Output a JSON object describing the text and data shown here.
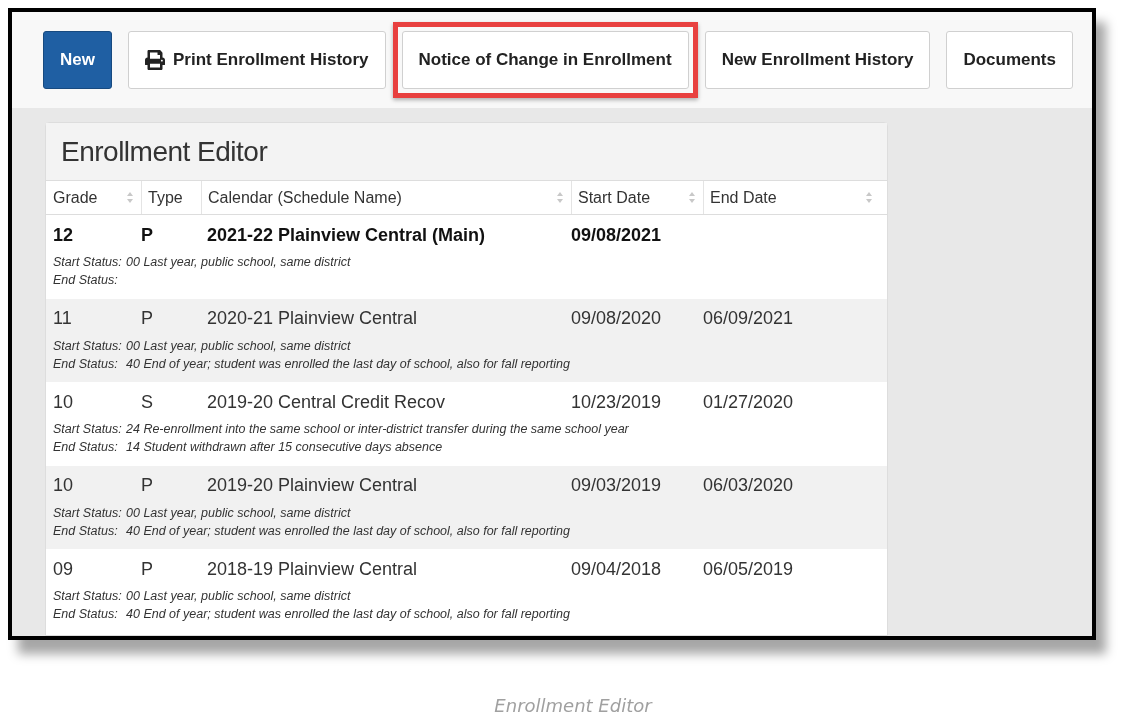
{
  "toolbar": {
    "buttons": [
      {
        "label": "New",
        "kind": "primary",
        "icon": false,
        "highlighted": false
      },
      {
        "label": "Print Enrollment History",
        "kind": "default",
        "icon": true,
        "highlighted": false
      },
      {
        "label": "Notice of Change in Enrollment",
        "kind": "default",
        "icon": false,
        "highlighted": true
      },
      {
        "label": "New Enrollment History",
        "kind": "default",
        "icon": false,
        "highlighted": false
      },
      {
        "label": "Documents",
        "kind": "default",
        "icon": false,
        "highlighted": false
      }
    ]
  },
  "editor": {
    "title": "Enrollment Editor",
    "columns": [
      {
        "label": "Grade",
        "sortable": true
      },
      {
        "label": "Type",
        "sortable": false
      },
      {
        "label": "Calendar (Schedule Name)",
        "sortable": true
      },
      {
        "label": "Start Date",
        "sortable": true
      },
      {
        "label": "End Date",
        "sortable": true
      }
    ],
    "rows": [
      {
        "grade": "12",
        "type": "P",
        "calendar": "2021-22 Plainview Central (Main)",
        "start_date": "09/08/2021",
        "selected": true,
        "start_status_label": "Start Status:",
        "start_status": "00 Last year, public school, same district",
        "end_status_label": "End Status:"
      },
      {
        "grade": "11",
        "type": "P",
        "calendar": "2020-21 Plainview Central",
        "start_date": "09/08/2020",
        "end_date": "06/09/2021",
        "selected": false,
        "start_status_label": "Start Status:",
        "start_status": "00 Last year, public school, same district",
        "end_status_label": "End Status:",
        "end_status": "40 End of year; student was enrolled the last day of school, also for fall reporting"
      },
      {
        "grade": "10",
        "type": "S",
        "calendar": "2019-20 Central Credit Recov",
        "start_date": "10/23/2019",
        "end_date": "01/27/2020",
        "selected": false,
        "start_status_label": "Start Status:",
        "start_status": "24 Re-enrollment into the same school or inter-district transfer during the same school year",
        "end_status_label": "End Status:",
        "end_status": "14 Student withdrawn after 15 consecutive days absence"
      },
      {
        "grade": "10",
        "type": "P",
        "calendar": "2019-20 Plainview Central",
        "start_date": "09/03/2019",
        "end_date": "06/03/2020",
        "selected": false,
        "start_status_label": "Start Status:",
        "start_status": "00 Last year, public school, same district",
        "end_status_label": "End Status:",
        "end_status": "40 End of year; student was enrolled the last day of school, also for fall reporting"
      },
      {
        "grade": "09",
        "type": "P",
        "calendar": "2018-19 Plainview Central",
        "start_date": "09/04/2018",
        "end_date": "06/05/2019",
        "selected": false,
        "start_status_label": "Start Status:",
        "start_status": "00 Last year, public school, same district",
        "end_status_label": "End Status:",
        "end_status": "40 End of year; student was enrolled the last day of school, also for fall reporting"
      }
    ]
  },
  "caption": "Enrollment Editor"
}
